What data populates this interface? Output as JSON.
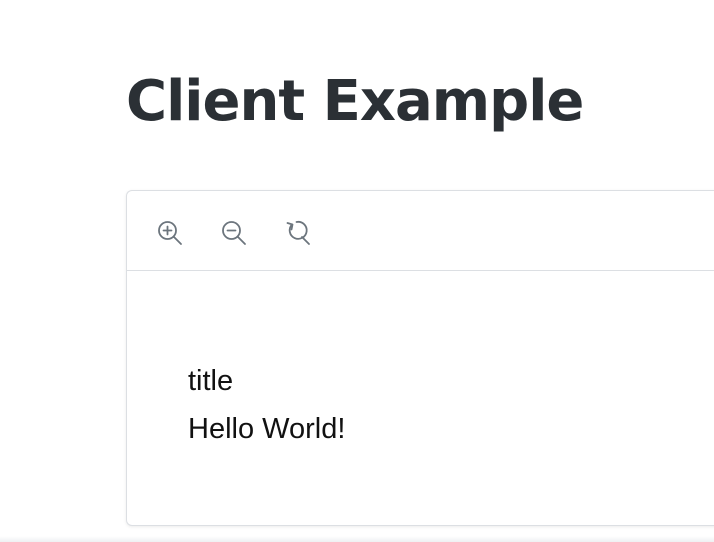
{
  "page": {
    "title": "Client Example"
  },
  "toolbar": {
    "buttons": [
      {
        "name": "zoom-in",
        "icon": "zoom-in-icon"
      },
      {
        "name": "zoom-out",
        "icon": "zoom-out-icon"
      },
      {
        "name": "reset",
        "icon": "rotate-reset-icon"
      }
    ]
  },
  "content": {
    "title": "title",
    "body": "Hello World!"
  },
  "colors": {
    "heading": "#2b3035",
    "icon": "#6c757d",
    "border": "#dcdfe3",
    "text": "#111111"
  }
}
